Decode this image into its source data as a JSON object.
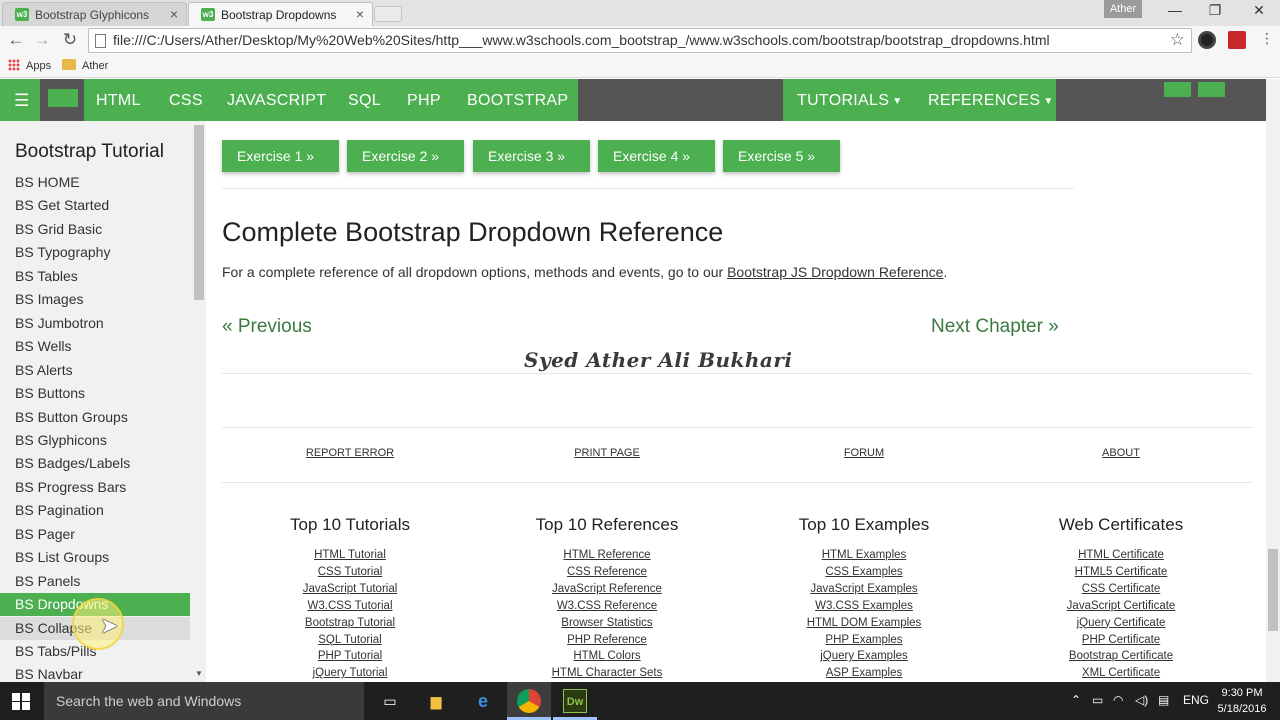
{
  "browser": {
    "tabs": [
      {
        "title": "Bootstrap Glyphicons",
        "favicon": "w3-icon",
        "active": false
      },
      {
        "title": "Bootstrap Dropdowns",
        "favicon": "w3-icon",
        "active": true
      }
    ],
    "user": "Ather",
    "url": "file:///C:/Users/Ather/Desktop/My%20Web%20Sites/http___www.w3schools.com_bootstrap_/www.w3schools.com/bootstrap/bootstrap_dropdowns.html",
    "bookmarks": [
      {
        "label": "Apps",
        "icon": "apps-grid-icon"
      },
      {
        "label": "Ather",
        "icon": "folder-icon"
      }
    ]
  },
  "topnav": {
    "menu_icon": "☰",
    "items": [
      "HTML",
      "CSS",
      "JAVASCRIPT",
      "SQL",
      "PHP",
      "BOOTSTRAP"
    ],
    "dropdowns": [
      "TUTORIALS",
      "REFERENCES"
    ]
  },
  "sidebar": {
    "heading": "Bootstrap Tutorial",
    "items": [
      "BS HOME",
      "BS Get Started",
      "BS Grid Basic",
      "BS Typography",
      "BS Tables",
      "BS Images",
      "BS Jumbotron",
      "BS Wells",
      "BS Alerts",
      "BS Buttons",
      "BS Button Groups",
      "BS Glyphicons",
      "BS Badges/Labels",
      "BS Progress Bars",
      "BS Pagination",
      "BS Pager",
      "BS List Groups",
      "BS Panels",
      "BS Dropdowns",
      "BS Collapse",
      "BS Tabs/Pills",
      "BS Navbar"
    ],
    "active_item": "BS Dropdowns"
  },
  "main": {
    "exercises": [
      "Exercise 1 »",
      "Exercise 2 »",
      "Exercise 3 »",
      "Exercise 4 »",
      "Exercise 5 »"
    ],
    "heading": "Complete Bootstrap Dropdown Reference",
    "text_before": "For a complete reference of all dropdown options, methods and events, go to our ",
    "text_link": "Bootstrap JS Dropdown Reference",
    "text_after": ".",
    "prev": "« Previous",
    "next": "Next Chapter »",
    "signature": "Syed Ather Ali Bukhari"
  },
  "footer": {
    "links": [
      "REPORT ERROR",
      "PRINT PAGE",
      "FORUM",
      "ABOUT"
    ],
    "columns": [
      {
        "title": "Top 10 Tutorials",
        "links": [
          "HTML Tutorial",
          "CSS Tutorial",
          "JavaScript Tutorial",
          "W3.CSS Tutorial",
          "Bootstrap Tutorial",
          "SQL Tutorial",
          "PHP Tutorial",
          "jQuery Tutorial"
        ]
      },
      {
        "title": "Top 10 References",
        "links": [
          "HTML Reference",
          "CSS Reference",
          "JavaScript Reference",
          "W3.CSS Reference",
          "Browser Statistics",
          "PHP Reference",
          "HTML Colors",
          "HTML Character Sets"
        ]
      },
      {
        "title": "Top 10 Examples",
        "links": [
          "HTML Examples",
          "CSS Examples",
          "JavaScript Examples",
          "W3.CSS Examples",
          "HTML DOM Examples",
          "PHP Examples",
          "jQuery Examples",
          "ASP Examples"
        ]
      },
      {
        "title": "Web Certificates",
        "links": [
          "HTML Certificate",
          "HTML5 Certificate",
          "CSS Certificate",
          "JavaScript Certificate",
          "jQuery Certificate",
          "PHP Certificate",
          "Bootstrap Certificate",
          "XML Certificate"
        ]
      }
    ]
  },
  "taskbar": {
    "search_placeholder": "Search the web and Windows",
    "apps": [
      "task-view-icon",
      "file-explorer-icon",
      "edge-icon",
      "chrome-icon",
      "dreamweaver-icon"
    ],
    "dreamweaver_label": "Dw",
    "language": "ENG",
    "time": "9:30 PM",
    "date": "5/18/2016"
  },
  "colors": {
    "accent": "#4caf50",
    "nav_dark": "#555555",
    "sidebar_bg": "#f1f1f1"
  }
}
